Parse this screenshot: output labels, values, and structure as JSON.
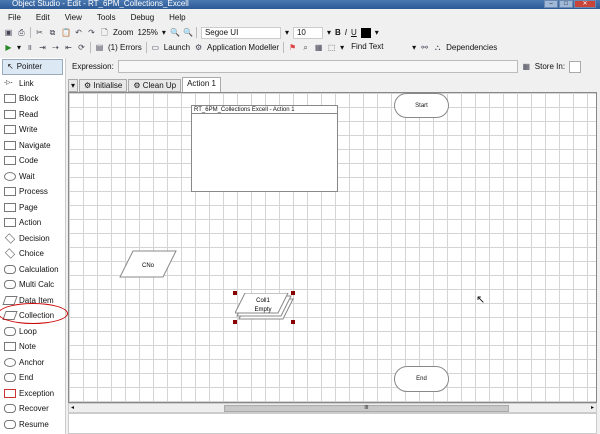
{
  "window": {
    "title": "Object Studio  - Edit - RT_6PM_Collections_Excell"
  },
  "menu": [
    "File",
    "Edit",
    "View",
    "Tools",
    "Debug",
    "Help"
  ],
  "toolbar1": {
    "zoom_label": "Zoom",
    "zoom_value": "125%",
    "font": "Segoe UI",
    "font_size": "10",
    "bold": "B",
    "italic": "I",
    "underline": "U",
    "color": "#000000"
  },
  "toolbar2": {
    "errors": "(1) Errors",
    "launch": "Launch",
    "app_modeller": "Application Modeller",
    "find_text": "Find Text",
    "dependencies": "Dependencies"
  },
  "sidebar": {
    "items": [
      "Pointer",
      "Link",
      "Block",
      "Read",
      "Write",
      "Navigate",
      "Code",
      "Wait",
      "Process",
      "Page",
      "Action",
      "Decision",
      "Choice",
      "Calculation",
      "Multi Calc",
      "Data Item",
      "Collection",
      "Loop",
      "Note",
      "Anchor",
      "End",
      "Exception",
      "Recover",
      "Resume"
    ],
    "selected": "Pointer",
    "highlighted": "Collection",
    "highlight_color": "#cc0000"
  },
  "expression": {
    "label": "Expression:",
    "value": "",
    "store_in_label": "Store In:"
  },
  "tabs": [
    {
      "label": "Initialise"
    },
    {
      "label": "Clean Up"
    },
    {
      "label": "Action 1",
      "active": true
    }
  ],
  "canvas": {
    "start": "Start",
    "end": "End",
    "note_title": "RT_6PM_Collections Excell - Action 1",
    "data_item": "CNo",
    "collection_name": "Coll1",
    "collection_value": "Empty"
  },
  "scrollbar": {
    "thumb_label": "III"
  }
}
